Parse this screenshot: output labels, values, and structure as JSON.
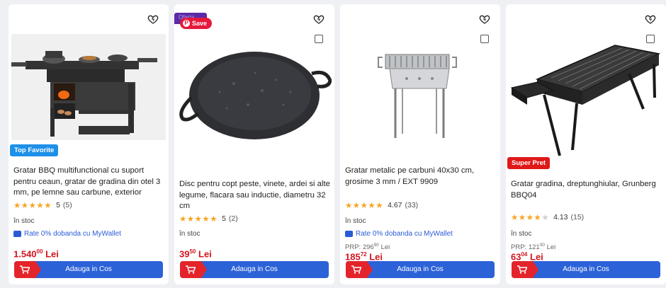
{
  "products": [
    {
      "badge": "Top Favorite",
      "title": "Gratar BBQ multifunctional cu suport pentru ceaun, gratar de gradina din otel 3 mm, pe lemne sau carbune, exterior",
      "rating": "5",
      "reviews": "(5)",
      "stars_full": 5,
      "stock": "în stoc",
      "wallet": "Rate 0% dobanda cu MyWallet",
      "price_int": "1.540",
      "price_dec": "00",
      "currency": "Lei",
      "cart_label": "Adauga in Cos",
      "icon": "product-bbq-station"
    },
    {
      "promo_tag": "Oferta",
      "save_label": "Save",
      "title": "Disc pentru copt peste, vinete, ardei si alte legume, flacara sau inductie, diametru 32 cm",
      "rating": "5",
      "reviews": "(2)",
      "stars_full": 5,
      "stock": "în stoc",
      "price_int": "39",
      "price_dec": "50",
      "currency": "Lei",
      "cart_label": "Adauga in Cos",
      "icon": "product-disc-pan"
    },
    {
      "title": "Gratar metalic pe carbuni 40x30 cm, grosime 3 mm / EXT 9909",
      "rating": "4.67",
      "reviews": "(33)",
      "stars_full": 5,
      "stock": "în stoc",
      "wallet": "Rate 0% dobanda cu MyWallet",
      "prp_label": "PRP:",
      "prp_int": "296",
      "prp_dec": "90",
      "prp_currency": "Lei",
      "price_int": "185",
      "price_dec": "72",
      "currency": "Lei",
      "cart_label": "Adauga in Cos",
      "icon": "product-charcoal-grill"
    },
    {
      "badge": "Super Pret",
      "title": "Gratar gradina, dreptunghiular, Grunberg BBQ04",
      "rating": "4.13",
      "reviews": "(15)",
      "stars_full": 4,
      "stock": "în stoc",
      "prp_label": "PRP:",
      "prp_int": "121",
      "prp_dec": "00",
      "prp_currency": "Lei",
      "price_int": "63",
      "price_dec": "04",
      "currency": "Lei",
      "cart_label": "Adauga in Cos",
      "icon": "product-rect-grill"
    }
  ],
  "colors": {
    "price": "#d4141d",
    "cart_button": "#2c62d8",
    "cart_icon_bg": "#e4242b",
    "top_favorite_badge": "#1e90e8",
    "super_pret_badge": "#e01818",
    "stars": "#f5a623",
    "wallet_link": "#2a5bd7"
  }
}
